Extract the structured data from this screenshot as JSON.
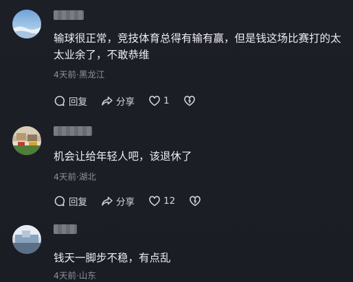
{
  "comments": [
    {
      "text": "输球很正常，竞技体育总得有输有赢，但是钱这场比赛打的太太业余了，不敢恭维",
      "meta": "4天前·黑龙江",
      "reply_label": "回复",
      "share_label": "分享",
      "likes": "1"
    },
    {
      "text": "机会让给年轻人吧，该退休了",
      "meta": "4天前·湖北",
      "reply_label": "回复",
      "share_label": "分享",
      "likes": "12"
    },
    {
      "text": "钱天一脚步不稳，有点乱",
      "meta": "4天前·山东"
    }
  ],
  "colors": {
    "background": "#1d1f27",
    "text": "#ececf1",
    "meta": "#8e909a"
  },
  "icons": [
    "reply-icon",
    "share-icon",
    "heart-icon",
    "dislike-icon"
  ]
}
